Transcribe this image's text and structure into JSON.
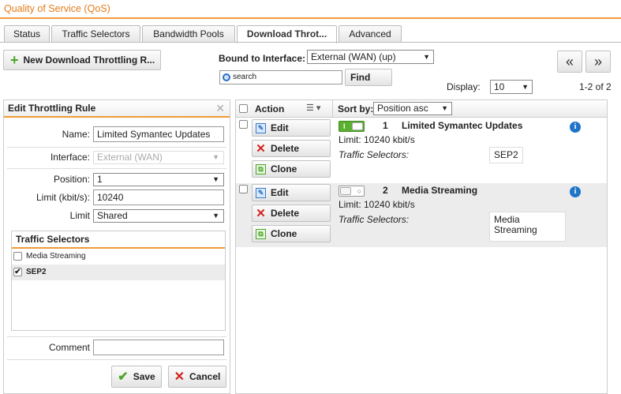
{
  "app": {
    "title": "Quality of Service (QoS)"
  },
  "tabs": [
    {
      "label": "Status"
    },
    {
      "label": "Traffic Selectors"
    },
    {
      "label": "Bandwidth Pools"
    },
    {
      "label": "Download Throt..."
    },
    {
      "label": "Advanced"
    }
  ],
  "toolbar": {
    "new_label": "New Download Throttling R...",
    "bound_label": "Bound to Interface:",
    "interface_value": "External (WAN) (up)",
    "search_placeholder": "search",
    "find_label": "Find",
    "prev_label": "«",
    "next_label": "»",
    "display_label": "Display:",
    "display_value": "10",
    "count": "1-2 of 2"
  },
  "edit_panel": {
    "title": "Edit Throttling Rule",
    "close_glyph": "✕",
    "name_label": "Name:",
    "name_value": "Limited Symantec Updates",
    "interface_label": "Interface:",
    "interface_value": "External (WAN)",
    "position_label": "Position:",
    "position_value": "1",
    "limit_label": "Limit (kbit/s):",
    "limit_value": "10240",
    "limit_type_label": "Limit",
    "limit_type_value": "Shared",
    "ts_title": "Traffic Selectors",
    "ts_items": [
      {
        "label": "Media Streaming",
        "checked": false
      },
      {
        "label": "SEP2",
        "checked": true
      }
    ],
    "comment_label": "Comment",
    "comment_value": "",
    "save_label": "Save",
    "cancel_label": "Cancel"
  },
  "list": {
    "action_header": "Action",
    "sort_label": "Sort by:",
    "sort_value": "Position asc",
    "edit_label": "Edit",
    "delete_label": "Delete",
    "clone_label": "Clone",
    "ts_label": "Traffic Selectors:",
    "rules": [
      {
        "number": "1",
        "name": "Limited Symantec Updates",
        "limit": "Limit: 10240 kbit/s",
        "selectors": "SEP2",
        "enabled": true
      },
      {
        "number": "2",
        "name": "Media Streaming",
        "limit": "Limit: 10240 kbit/s",
        "selectors": "Media Streaming",
        "enabled": false
      }
    ]
  },
  "colors": {
    "accent": "#f29a38",
    "title": "#e57c1a",
    "green": "#4ea52c",
    "red": "#d2231e",
    "info_blue": "#1f74c8"
  }
}
